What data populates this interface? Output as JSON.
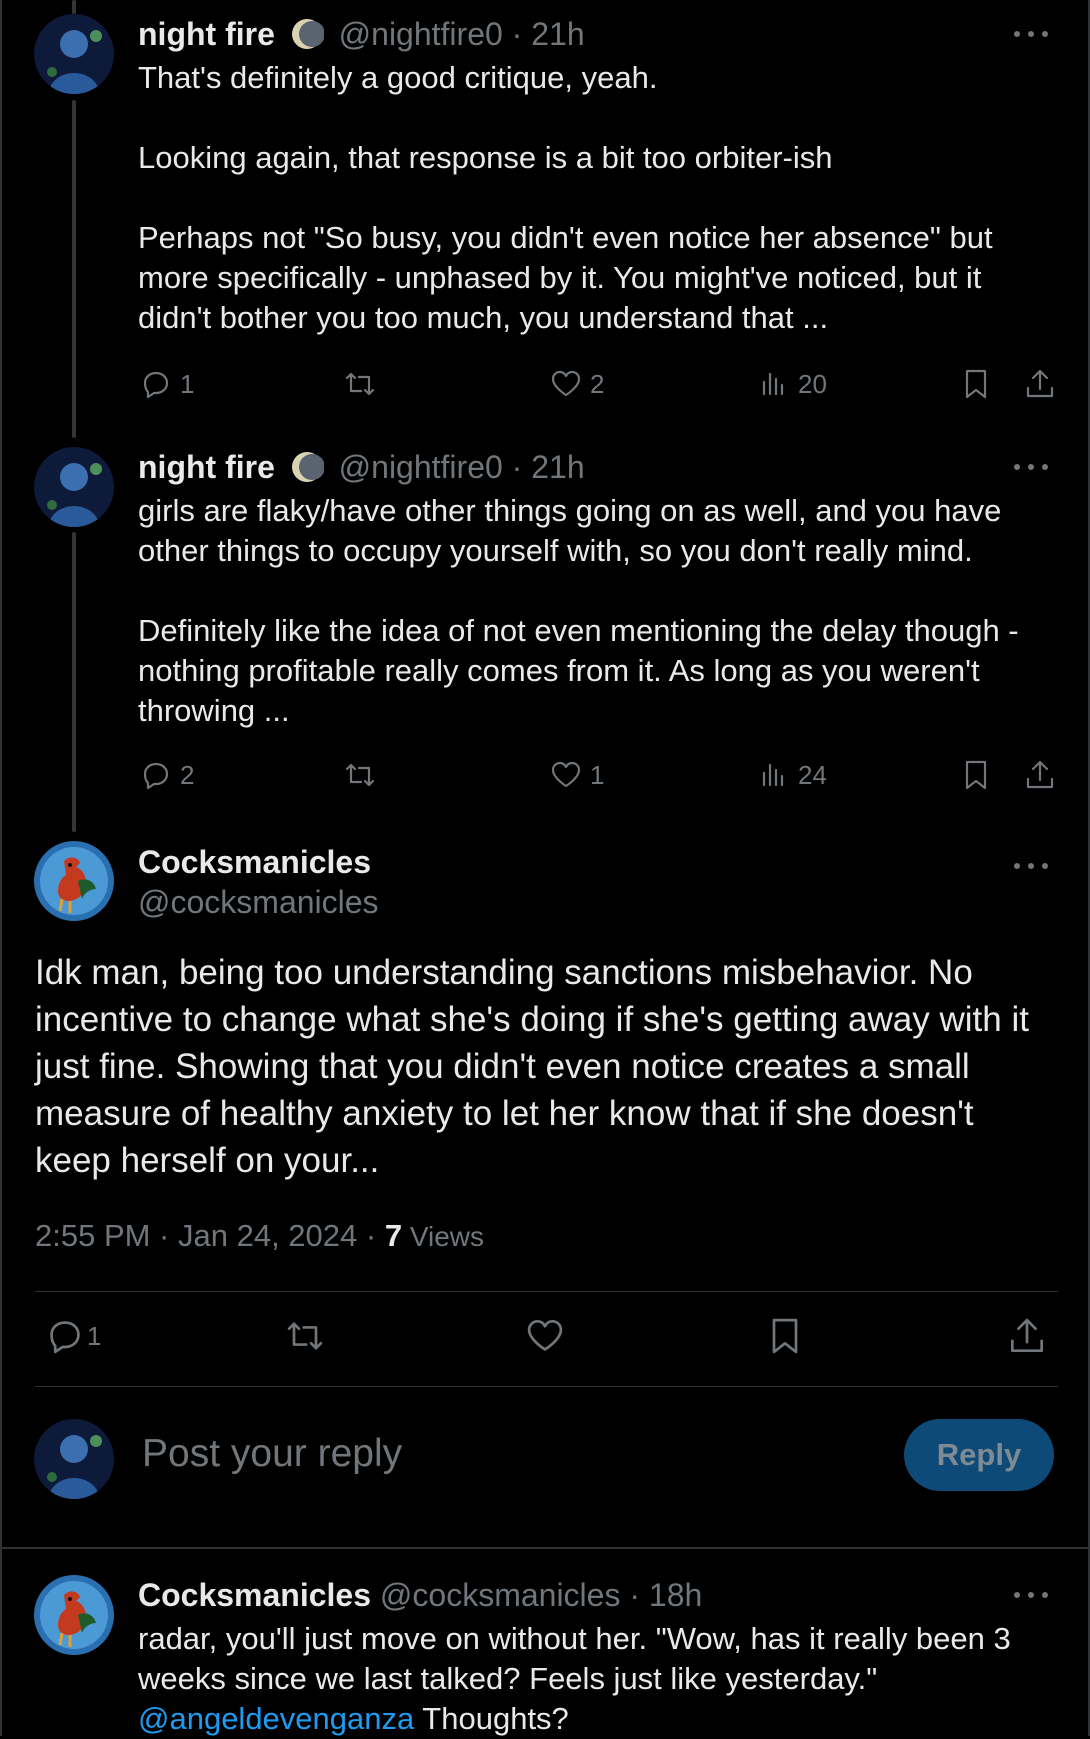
{
  "thread": [
    {
      "name": "night fire",
      "handle": "@nightfire0",
      "time": "· 21h",
      "text": "That's definitely a good critique, yeah.\n\nLooking again, that response is a bit too orbiter-ish\n\nPerhaps not \"So busy, you didn't even notice her absence\" but more specifically - unphased by it. You might've noticed, but it didn't bother you too much, you understand that ...",
      "replies": "1",
      "retweets": "",
      "likes": "2",
      "views": "20"
    },
    {
      "name": "night fire",
      "handle": "@nightfire0",
      "time": "· 21h",
      "text": "girls are flaky/have other things going on as well, and you have other things to occupy yourself with, so you don't really mind.\n\nDefinitely like the idea of not even mentioning the delay though - nothing profitable really comes from it. As long as you weren't throwing ...",
      "replies": "2",
      "retweets": "",
      "likes": "1",
      "views": "24"
    }
  ],
  "main": {
    "name": "Cocksmanicles",
    "handle": "@cocksmanicles",
    "text": "Idk man, being too understanding sanctions misbehavior. No incentive to change what she's doing if she's getting away with it just fine. Showing that you didn't even notice creates a small measure of healthy anxiety to let her know that if she doesn't keep herself on your...",
    "timestamp": "2:55 PM · Jan 24, 2024 · ",
    "views_count": "7",
    "views_label": " Views",
    "replies": "1"
  },
  "composer": {
    "placeholder": "Post your reply",
    "button": "Reply"
  },
  "reply": {
    "name": "Cocksmanicles",
    "handle": "@cocksmanicles",
    "time": "· 18h",
    "text": "radar, you'll just move on without her. \"Wow, has it really been 3 weeks since we last talked? Feels just like yesterday.\"",
    "mention": "@angeldevenganza",
    "text_after": " Thoughts?"
  },
  "colors": {
    "background": "#000000",
    "text": "#e7e9ea",
    "muted": "#71767b",
    "link": "#1d9bf0",
    "reply_button": "#0d4a78"
  }
}
